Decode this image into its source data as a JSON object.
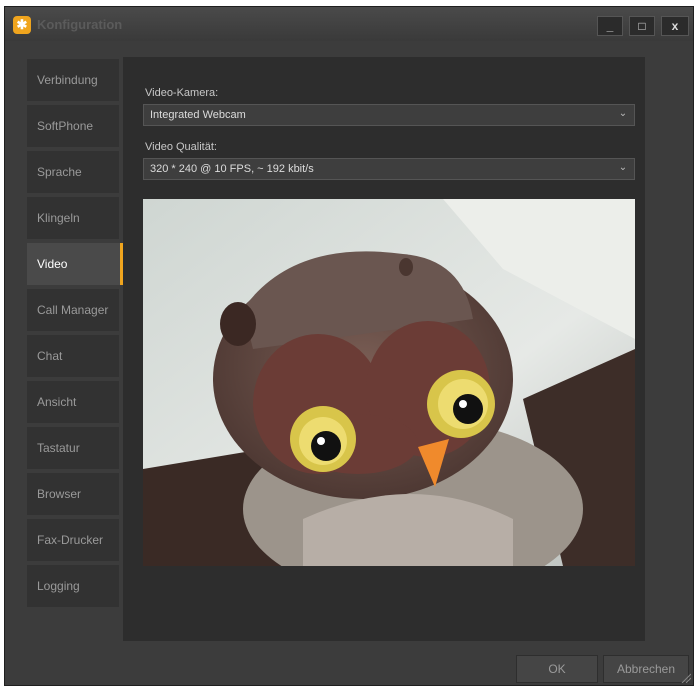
{
  "window": {
    "title": "Konfiguration",
    "min_label": "_",
    "max_label": "□",
    "close_label": "x"
  },
  "sidebar": {
    "items": [
      {
        "label": "Verbindung"
      },
      {
        "label": "SoftPhone"
      },
      {
        "label": "Sprache"
      },
      {
        "label": "Klingeln"
      },
      {
        "label": "Video"
      },
      {
        "label": "Call Manager"
      },
      {
        "label": "Chat"
      },
      {
        "label": "Ansicht"
      },
      {
        "label": "Tastatur"
      },
      {
        "label": "Browser"
      },
      {
        "label": "Fax-Drucker"
      },
      {
        "label": "Logging"
      }
    ],
    "active": "Video"
  },
  "video": {
    "camera_label": "Video-Kamera:",
    "camera_value": "Integrated Webcam",
    "quality_label": "Video Qualität:",
    "quality_value": "320 * 240 @ 10 FPS, ~ 192 kbit/s"
  },
  "footer": {
    "ok_label": "OK",
    "cancel_label": "Abbrechen"
  },
  "colors": {
    "accent": "#f0a51e",
    "frame": "#3c3c3c",
    "panel": "#2d2d2d"
  }
}
